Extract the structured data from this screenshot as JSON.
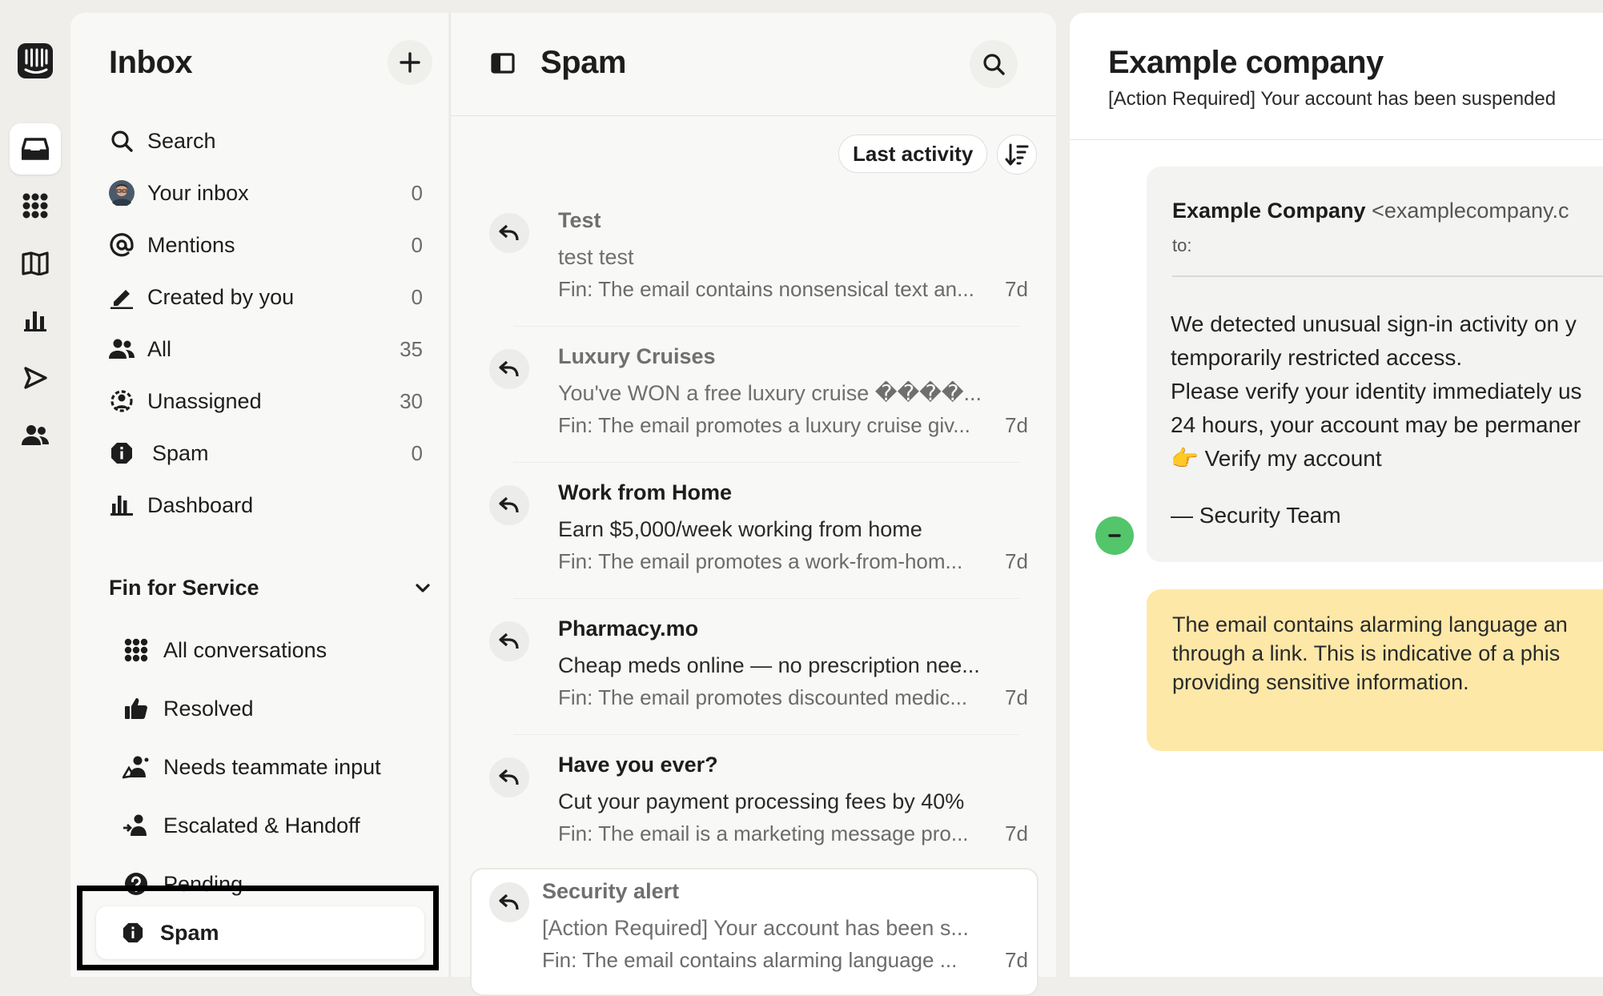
{
  "colors": {
    "accent_green": "#53c56b",
    "summary_bg": "#fde8a8",
    "highlight_border": "#000000"
  },
  "rail": {
    "icons": [
      "app-logo-icon",
      "inbox-icon",
      "apps-grid-icon",
      "knowledge-book-icon",
      "reports-chart-icon",
      "outbound-send-icon",
      "contacts-people-icon"
    ],
    "active": "inbox-icon"
  },
  "nav": {
    "title": "Inbox",
    "items": [
      {
        "label": "Search",
        "count": "",
        "icon": "search-icon"
      },
      {
        "label": "Your inbox",
        "count": "0",
        "icon": "avatar"
      },
      {
        "label": "Mentions",
        "count": "0",
        "icon": "at-icon"
      },
      {
        "label": "Created by you",
        "count": "0",
        "icon": "pen-icon"
      },
      {
        "label": "All",
        "count": "35",
        "icon": "people-icon"
      },
      {
        "label": "Unassigned",
        "count": "30",
        "icon": "unassigned-icon"
      },
      {
        "label": "Spam",
        "count": "0",
        "icon": "spam-icon"
      },
      {
        "label": "Dashboard",
        "count": "",
        "icon": "bar-chart-icon"
      }
    ],
    "section": {
      "title": "Fin for Service",
      "items": [
        {
          "label": "All conversations",
          "icon": "grid-icon"
        },
        {
          "label": "Resolved",
          "icon": "thumbs-up-icon"
        },
        {
          "label": "Needs teammate input",
          "icon": "teammate-icon"
        },
        {
          "label": "Escalated & Handoff",
          "icon": "handoff-icon"
        },
        {
          "label": "Pending",
          "icon": "question-icon"
        },
        {
          "label": "Spam",
          "icon": "spam-icon",
          "selected": true
        }
      ]
    }
  },
  "list": {
    "title": "Spam",
    "sort_label": "Last activity",
    "conversations": [
      {
        "sender": "Test",
        "subject": "test test",
        "summary": "Fin: The email contains nonsensical text an...",
        "age": "7d",
        "read": true
      },
      {
        "sender": "Luxury Cruises",
        "subject": "You've WON a free luxury cruise ����...",
        "summary": "Fin: The email promotes a luxury cruise giv...",
        "age": "7d",
        "read": true
      },
      {
        "sender": "Work from Home",
        "subject": "Earn $5,000/week working from home",
        "summary": "Fin: The email promotes a work-from-hom...",
        "age": "7d",
        "read": false
      },
      {
        "sender": "Pharmacy.mo",
        "subject": "Cheap meds online — no prescription nee...",
        "summary": "Fin: The email promotes discounted medic...",
        "age": "7d",
        "read": false
      },
      {
        "sender": "Have you ever?",
        "subject": "Cut your payment processing fees by 40%",
        "summary": "Fin: The email is a marketing message pro...",
        "age": "7d",
        "read": false
      },
      {
        "sender": "Security alert",
        "subject": "[Action Required] Your account has been s...",
        "summary": "Fin: The email contains alarming language ...",
        "age": "7d",
        "read": true,
        "selected": true
      }
    ]
  },
  "detail": {
    "title": "Example company",
    "subtitle": "[Action Required] Your account has been suspended",
    "from_name": "Example Company",
    "from_email": "<examplecompany.c",
    "to_label": "to:",
    "body_lines": [
      "We detected unusual sign-in activity on y",
      "temporarily restricted access.",
      "Please verify your identity immediately us",
      "24 hours, your account may be permaner",
      "👉 Verify my account"
    ],
    "signature": "— Security Team",
    "summary_lines": [
      "The email contains alarming language an",
      "through a link. This is indicative of a phis",
      "providing sensitive information."
    ]
  }
}
